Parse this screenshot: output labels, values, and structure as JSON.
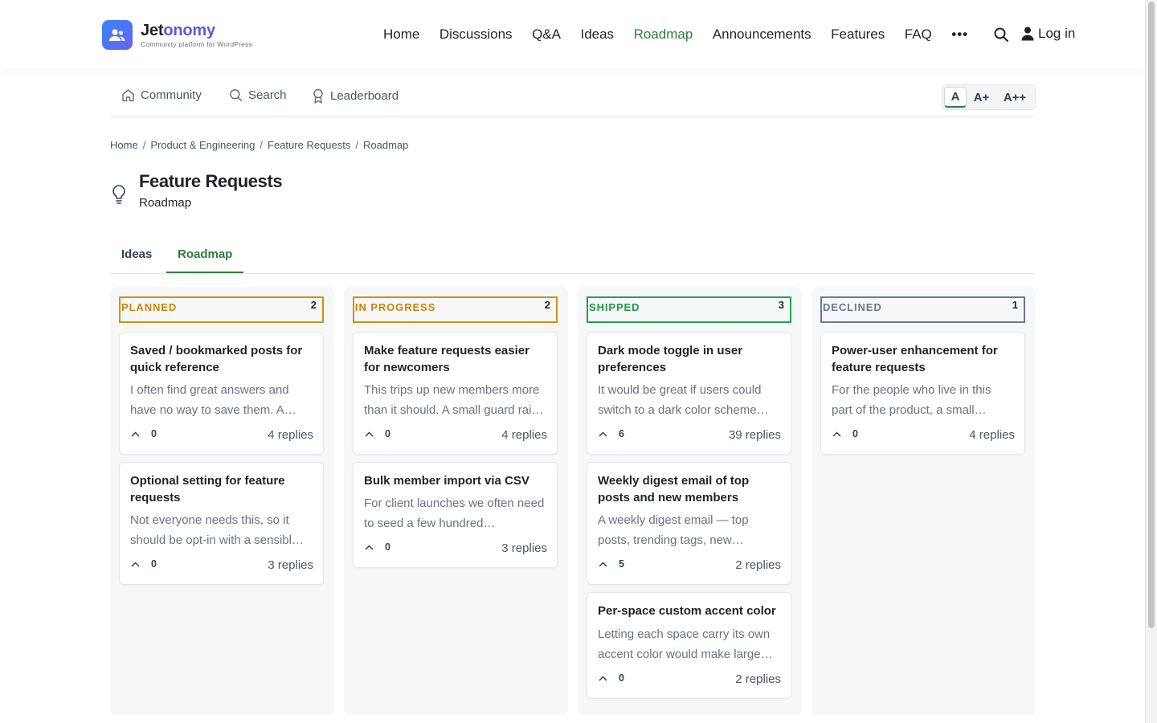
{
  "brand": {
    "name_a": "Jet",
    "name_b": "onomy",
    "tagline": "Community platform for WordPress"
  },
  "nav": {
    "items": [
      {
        "label": "Home",
        "active": false
      },
      {
        "label": "Discussions",
        "active": false
      },
      {
        "label": "Q&A",
        "active": false
      },
      {
        "label": "Ideas",
        "active": false
      },
      {
        "label": "Roadmap",
        "active": true
      },
      {
        "label": "Announcements",
        "active": false
      },
      {
        "label": "Features",
        "active": false
      },
      {
        "label": "FAQ",
        "active": false
      }
    ],
    "more": "•••",
    "login": "Log in"
  },
  "subnav": {
    "community": "Community",
    "search": "Search",
    "leaderboard": "Leaderboard",
    "fontsize": [
      "A",
      "A+",
      "A++"
    ]
  },
  "breadcrumb": [
    "Home",
    "Product & Engineering",
    "Feature Requests",
    "Roadmap"
  ],
  "page": {
    "title": "Feature Requests",
    "subtitle": "Roadmap"
  },
  "tabs": {
    "ideas": "Ideas",
    "roadmap": "Roadmap"
  },
  "colors": {
    "accent": "#2f7d3c",
    "planned": "#d4900a",
    "in_progress": "#d4900a",
    "shipped": "#22a447",
    "declined": "#6b7a8f"
  },
  "board": {
    "columns": [
      {
        "name": "PLANNED",
        "count": "2",
        "cards": [
          {
            "title": "Saved / bookmarked posts for quick reference",
            "body": "I often find great answers and have no way to save them. A…",
            "votes": "0",
            "replies": "4 replies"
          },
          {
            "title": "Optional setting for feature requests",
            "body": "Not everyone needs this, so it should be opt-in with a sensibl…",
            "votes": "0",
            "replies": "3 replies"
          }
        ]
      },
      {
        "name": "IN PROGRESS",
        "count": "2",
        "cards": [
          {
            "title": "Make feature requests easier for newcomers",
            "body": "This trips up new members more than it should. A small guard rai…",
            "votes": "0",
            "replies": "4 replies"
          },
          {
            "title": "Bulk member import via CSV",
            "body": "For client launches we often need to seed a few hundred…",
            "votes": "0",
            "replies": "3 replies"
          }
        ]
      },
      {
        "name": "SHIPPED",
        "count": "3",
        "cards": [
          {
            "title": "Dark mode toggle in user preferences",
            "body": "It would be great if users could switch to a dark color scheme…",
            "votes": "6",
            "replies": "39 replies"
          },
          {
            "title": "Weekly digest email of top posts and new members",
            "body": "A weekly digest email — top posts, trending tags, new…",
            "votes": "5",
            "replies": "2 replies"
          },
          {
            "title": "Per-space custom accent color",
            "body": "Letting each space carry its own accent color would make large…",
            "votes": "0",
            "replies": "2 replies"
          }
        ]
      },
      {
        "name": "DECLINED",
        "count": "1",
        "cards": [
          {
            "title": "Power-user enhancement for feature requests",
            "body": "For the people who live in this part of the product, a small…",
            "votes": "0",
            "replies": "4 replies"
          }
        ]
      }
    ]
  }
}
